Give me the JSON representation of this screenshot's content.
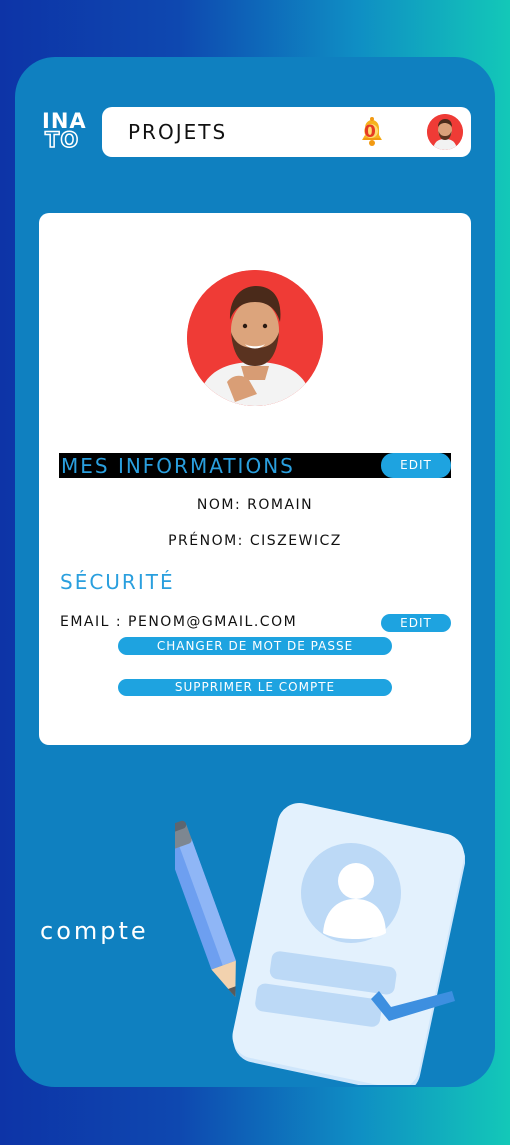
{
  "brand": {
    "logo_line1": "INA",
    "logo_line2": "TO"
  },
  "header": {
    "title": "PROJETS",
    "notification_count": "0"
  },
  "profile": {
    "section_title": "MES INFORMATIONS",
    "edit_label": "EDIT",
    "nom": "NOM: ROMAIN",
    "prenom": "PRÉNOM: CISZEWICZ"
  },
  "security": {
    "section_title": "SÉCURITÉ",
    "email": "EMAIL : PENOM@GMAIL.COM",
    "edit_label": "EDIT",
    "change_password_label": "CHANGER DE MOT DE PASSE",
    "delete_account_label": "SUPPRIMER LE COMPTE"
  },
  "page_label": "compte",
  "colors": {
    "accent": "#1ea3e0",
    "frame": "#0f80c0",
    "avatar_bg": "#ef3b36"
  }
}
